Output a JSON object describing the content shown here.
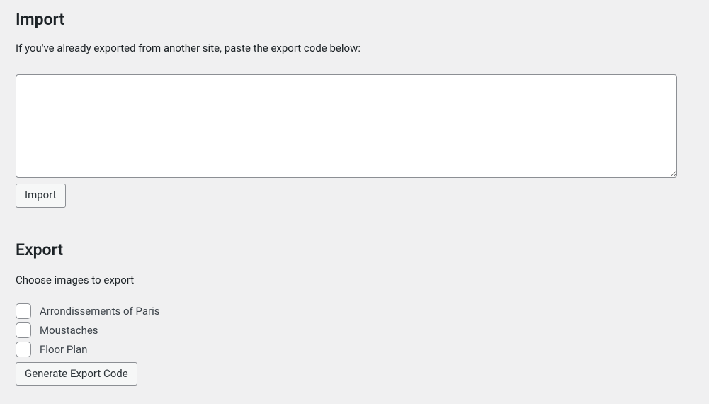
{
  "import": {
    "heading": "Import",
    "description": "If you've already exported from another site, paste the export code below:",
    "textarea_value": "",
    "button_label": "Import"
  },
  "export": {
    "heading": "Export",
    "description": "Choose images to export",
    "items": [
      {
        "label": "Arrondissements of Paris",
        "checked": false
      },
      {
        "label": "Moustaches",
        "checked": false
      },
      {
        "label": "Floor Plan",
        "checked": false
      }
    ],
    "button_label": "Generate Export Code"
  }
}
